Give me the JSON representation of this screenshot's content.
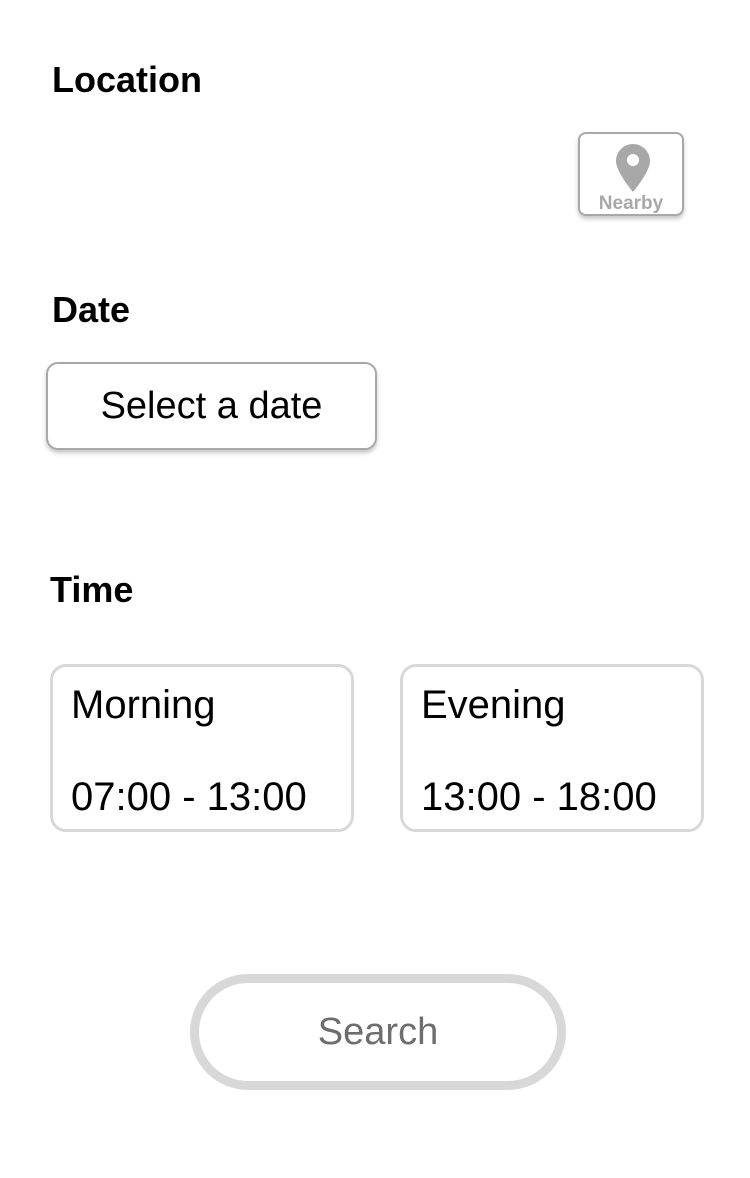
{
  "location": {
    "heading": "Location",
    "nearby_button": {
      "label": "Nearby",
      "icon": "map-pin-icon"
    }
  },
  "date": {
    "heading": "Date",
    "select_button_label": "Select a date"
  },
  "time": {
    "heading": "Time",
    "slots": [
      {
        "name": "Morning",
        "range": "07:00 - 13:00"
      },
      {
        "name": "Evening",
        "range": "13:00 - 18:00"
      }
    ]
  },
  "search": {
    "label": "Search"
  },
  "colors": {
    "text": "#000000",
    "muted_gray": "#a8a8a8",
    "border_light": "#d8d8d8",
    "search_text": "#6d6d6d",
    "background": "#ffffff"
  }
}
